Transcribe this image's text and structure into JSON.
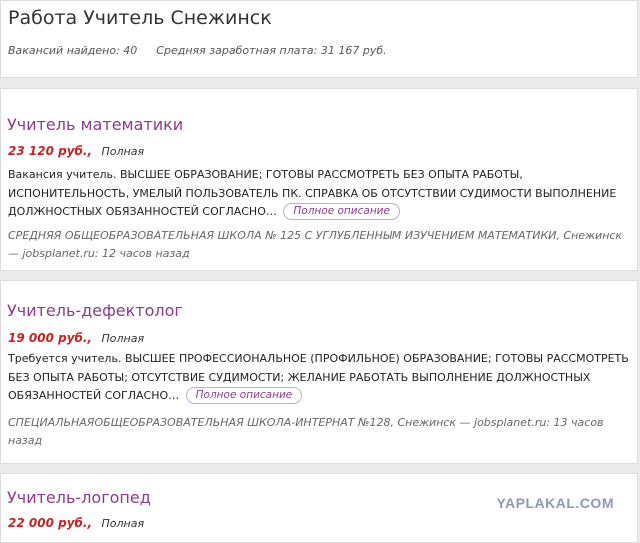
{
  "page": {
    "title": "Работа Учитель Снежинск"
  },
  "stats": {
    "found_label": "Вакансий найдено:",
    "found_count": "40",
    "salary_label": "Средняя заработная плата:",
    "salary_value": "31 167 руб."
  },
  "vacancies": [
    {
      "title": "Учитель математики",
      "salary": "23 120 руб.,",
      "employment": "Полная",
      "description": "Вакансия учитель. ВЫСШЕЕ ОБРАЗОВАНИЕ; ГОТОВЫ РАССМОТРЕТЬ БЕЗ ОПЫТА РАБОТЫ, ИСПОНИТЕЛЬНОСТЬ, УМЕЛЫЙ ПОЛЬЗОВАТЕЛЬ ПК. СПРАВКА ОБ ОТСУТСТВИИ СУДИМОСТИ ВЫПОЛНЕНИЕ ДОЛЖНОСТНЫХ ОБЯЗАННОСТЕЙ СОГЛАСНО…",
      "more_label": "Полное описание",
      "meta": "СРЕДНЯЯ ОБЩЕОБРАЗОВАТЕЛЬНАЯ ШКОЛА № 125 С УГЛУБЛЕННЫМ ИЗУЧЕНИЕМ МАТЕМАТИКИ, Снежинск — jobsplanet.ru: 12 часов назад"
    },
    {
      "title": "Учитель-дефектолог",
      "salary": "19 000 руб.,",
      "employment": "Полная",
      "description": "Требуется учитель. ВЫСШЕЕ ПРОФЕССИОНАЛЬНОЕ (ПРОФИЛЬНОЕ) ОБРАЗОВАНИЕ; ГОТОВЫ РАССМОТРЕТЬ БЕЗ ОПЫТА РАБОТЫ; ОТСУТСТВИЕ СУДИМОСТИ; ЖЕЛАНИЕ РАБОТАТЬ ВЫПОЛНЕНИЕ ДОЛЖНОСТНЫХ ОБЯЗАННОСТЕЙ СОГЛАСНО…",
      "more_label": "Полное описание",
      "meta": "СПЕЦИАЛЬНАЯОБЩЕОБРАЗОВАТЕЛЬНАЯ ШКОЛА-ИНТЕРНАТ №128, Снежинск — jobsplanet.ru: 13 часов назад"
    },
    {
      "title": "Учитель-логопед",
      "salary": "22 000 руб.,",
      "employment": "Полная"
    }
  ],
  "watermark": "YAPLAKAL.COM"
}
